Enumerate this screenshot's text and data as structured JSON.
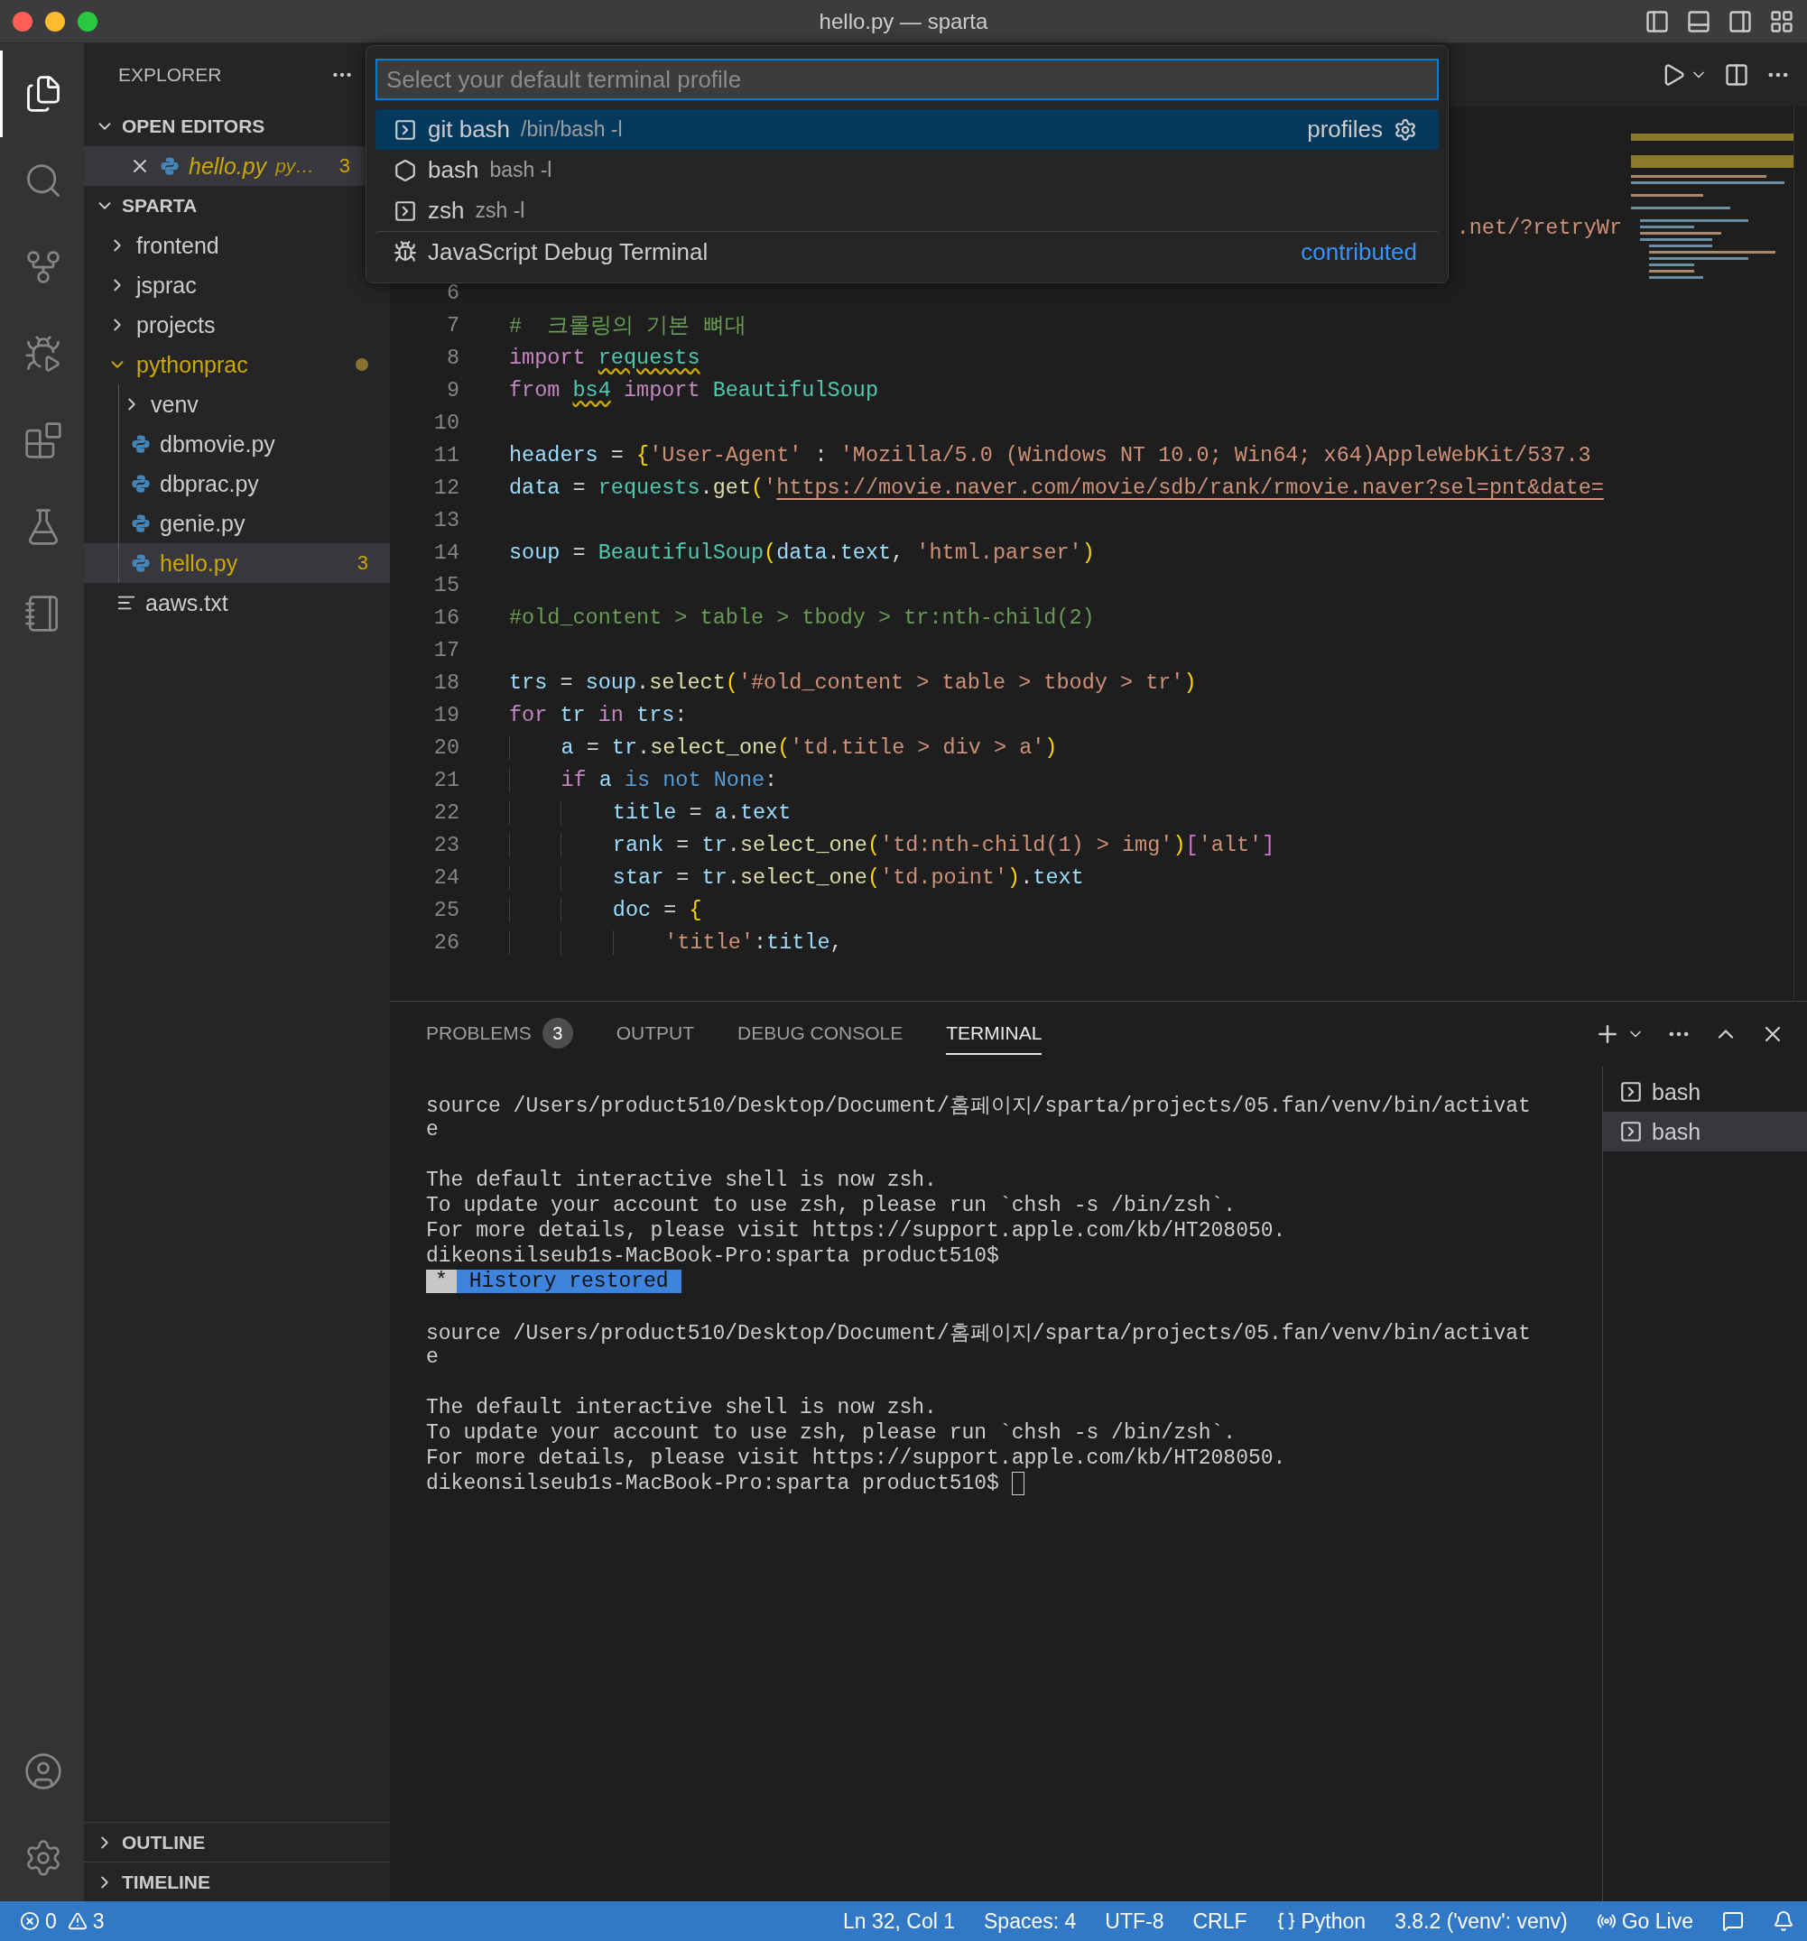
{
  "window": {
    "title": "hello.py — sparta"
  },
  "activity_bar": {
    "items": [
      {
        "kind": "files",
        "selected": true
      },
      {
        "kind": "search",
        "selected": false
      },
      {
        "kind": "source-control",
        "selected": false
      },
      {
        "kind": "run-debug",
        "selected": false
      },
      {
        "kind": "extensions",
        "selected": false
      },
      {
        "kind": "testing",
        "selected": false
      },
      {
        "kind": "notebook",
        "selected": false
      }
    ],
    "bottom": [
      {
        "kind": "account"
      },
      {
        "kind": "settings"
      }
    ]
  },
  "sidebar": {
    "title": "EXPLORER",
    "open_editors": {
      "title": "OPEN EDITORS",
      "expanded": true,
      "items": [
        {
          "name": "hello.py",
          "description": "py…",
          "badge": "3",
          "warning": true,
          "selected": true
        }
      ]
    },
    "tree": {
      "title": "SPARTA",
      "expanded": true,
      "items": [
        {
          "name": "frontend",
          "kind": "folder",
          "expanded": false,
          "warning": false,
          "selected": false
        },
        {
          "name": "jsprac",
          "kind": "folder",
          "expanded": false,
          "warning": false,
          "selected": false
        },
        {
          "name": "projects",
          "kind": "folder",
          "expanded": false,
          "warning": false,
          "selected": false
        },
        {
          "name": "pythonprac",
          "kind": "folder",
          "expanded": true,
          "warning": true,
          "selected": false,
          "children": [
            {
              "name": "venv",
              "kind": "folder",
              "expanded": false,
              "warning": false,
              "selected": false
            },
            {
              "name": "dbmovie.py",
              "kind": "python",
              "warning": false,
              "selected": false
            },
            {
              "name": "dbprac.py",
              "kind": "python",
              "warning": false,
              "selected": false
            },
            {
              "name": "genie.py",
              "kind": "python",
              "warning": false,
              "selected": false
            },
            {
              "name": "hello.py",
              "kind": "python",
              "warning": true,
              "badge": "3",
              "selected": true
            }
          ]
        },
        {
          "name": "aaws.txt",
          "kind": "text",
          "warning": false,
          "selected": false
        }
      ]
    },
    "collapsed_sections": [
      {
        "title": "OUTLINE",
        "expanded": false
      },
      {
        "title": "TIMELINE",
        "expanded": false
      }
    ]
  },
  "quick_pick": {
    "placeholder": "Select your default terminal profile",
    "items": [
      {
        "kind": "terminal",
        "label": "git bash",
        "detail": "/bin/bash -l",
        "action": "profiles",
        "selected": true
      },
      {
        "kind": "shell",
        "label": "bash",
        "detail": "bash -l",
        "selected": false
      },
      {
        "kind": "terminal",
        "label": "zsh",
        "detail": "zsh -l",
        "selected": false
      },
      {
        "kind": "debug",
        "label": "JavaScript Debug Terminal",
        "group": "contributed",
        "separator": true,
        "selected": false
      }
    ]
  },
  "editor": {
    "covered_tail": ".net/?retryWr",
    "lines": [
      {
        "n": "6"
      },
      {
        "n": "7",
        "tokens": [
          {
            "kind": "cmt",
            "text": "#  크롤링의 기본 뼈대"
          }
        ]
      },
      {
        "n": "8",
        "tokens": [
          {
            "kind": "kw",
            "text": "import "
          },
          {
            "kind": "mod",
            "text": "requests",
            "warn": true
          }
        ]
      },
      {
        "n": "9",
        "tokens": [
          {
            "kind": "kw",
            "text": "from "
          },
          {
            "kind": "mod",
            "text": "bs4",
            "warn": true
          },
          {
            "kind": "kw",
            "text": " import "
          },
          {
            "kind": "mod",
            "text": "BeautifulSoup"
          }
        ]
      },
      {
        "n": "10"
      },
      {
        "n": "11",
        "tokens": [
          {
            "kind": "var",
            "text": "headers"
          },
          {
            "kind": "op",
            "text": " = "
          },
          {
            "kind": "brace",
            "text": "{"
          },
          {
            "kind": "str",
            "text": "'User-Agent'"
          },
          {
            "kind": "op",
            "text": " : "
          },
          {
            "kind": "str",
            "text": "'Mozilla/5.0 (Windows NT 10.0; Win64; x64)AppleWebKit/537.3"
          }
        ]
      },
      {
        "n": "12",
        "tokens": [
          {
            "kind": "var",
            "text": "data"
          },
          {
            "kind": "op",
            "text": " = "
          },
          {
            "kind": "mod",
            "text": "requests"
          },
          {
            "kind": "op",
            "text": "."
          },
          {
            "kind": "fn",
            "text": "get"
          },
          {
            "kind": "brace",
            "text": "("
          },
          {
            "kind": "str",
            "text": "'"
          },
          {
            "kind": "link",
            "text": "https://movie.naver.com/movie/sdb/rank/rmovie.naver?sel=pnt&date="
          }
        ]
      },
      {
        "n": "13"
      },
      {
        "n": "14",
        "tokens": [
          {
            "kind": "var",
            "text": "soup"
          },
          {
            "kind": "op",
            "text": " = "
          },
          {
            "kind": "mod",
            "text": "BeautifulSoup"
          },
          {
            "kind": "brace",
            "text": "("
          },
          {
            "kind": "var",
            "text": "data"
          },
          {
            "kind": "op",
            "text": "."
          },
          {
            "kind": "var",
            "text": "text"
          },
          {
            "kind": "op",
            "text": ", "
          },
          {
            "kind": "str",
            "text": "'html.parser'"
          },
          {
            "kind": "brace",
            "text": ")"
          }
        ]
      },
      {
        "n": "15"
      },
      {
        "n": "16",
        "tokens": [
          {
            "kind": "cmt",
            "text": "#old_content > table > tbody > tr:nth-child(2)"
          }
        ]
      },
      {
        "n": "17"
      },
      {
        "n": "18",
        "tokens": [
          {
            "kind": "var",
            "text": "trs"
          },
          {
            "kind": "op",
            "text": " = "
          },
          {
            "kind": "var",
            "text": "soup"
          },
          {
            "kind": "op",
            "text": "."
          },
          {
            "kind": "fn",
            "text": "select"
          },
          {
            "kind": "brace",
            "text": "("
          },
          {
            "kind": "str",
            "text": "'#old_content > table > tbody > tr'"
          },
          {
            "kind": "brace",
            "text": ")"
          }
        ]
      },
      {
        "n": "19",
        "tokens": [
          {
            "kind": "kw",
            "text": "for "
          },
          {
            "kind": "var",
            "text": "tr "
          },
          {
            "kind": "kw",
            "text": "in "
          },
          {
            "kind": "var",
            "text": "trs"
          },
          {
            "kind": "op",
            "text": ":"
          }
        ]
      },
      {
        "n": "20",
        "tokens": [
          {
            "kind": "var",
            "text": "    a"
          },
          {
            "kind": "op",
            "text": " = "
          },
          {
            "kind": "var",
            "text": "tr"
          },
          {
            "kind": "op",
            "text": "."
          },
          {
            "kind": "fn",
            "text": "select_one"
          },
          {
            "kind": "brace",
            "text": "("
          },
          {
            "kind": "str",
            "text": "'td.title > div > a'"
          },
          {
            "kind": "brace",
            "text": ")"
          }
        ]
      },
      {
        "n": "21",
        "tokens": [
          {
            "kind": "kw",
            "text": "    if "
          },
          {
            "kind": "var",
            "text": "a "
          },
          {
            "kind": "const",
            "text": "is not "
          },
          {
            "kind": "const",
            "text": "None"
          },
          {
            "kind": "op",
            "text": ":"
          }
        ]
      },
      {
        "n": "22",
        "tokens": [
          {
            "kind": "var",
            "text": "        title"
          },
          {
            "kind": "op",
            "text": " = "
          },
          {
            "kind": "var",
            "text": "a"
          },
          {
            "kind": "op",
            "text": "."
          },
          {
            "kind": "var",
            "text": "text"
          }
        ]
      },
      {
        "n": "23",
        "tokens": [
          {
            "kind": "var",
            "text": "        rank"
          },
          {
            "kind": "op",
            "text": " = "
          },
          {
            "kind": "var",
            "text": "tr"
          },
          {
            "kind": "op",
            "text": "."
          },
          {
            "kind": "fn",
            "text": "select_one"
          },
          {
            "kind": "brace",
            "text": "("
          },
          {
            "kind": "str",
            "text": "'td:nth-child(1) > img'"
          },
          {
            "kind": "brace",
            "text": ")"
          },
          {
            "kind": "brace2",
            "text": "["
          },
          {
            "kind": "str",
            "text": "'alt'"
          },
          {
            "kind": "brace2",
            "text": "]"
          }
        ]
      },
      {
        "n": "24",
        "tokens": [
          {
            "kind": "var",
            "text": "        star"
          },
          {
            "kind": "op",
            "text": " = "
          },
          {
            "kind": "var",
            "text": "tr"
          },
          {
            "kind": "op",
            "text": "."
          },
          {
            "kind": "fn",
            "text": "select_one"
          },
          {
            "kind": "brace",
            "text": "("
          },
          {
            "kind": "str",
            "text": "'td.point'"
          },
          {
            "kind": "brace",
            "text": ")"
          },
          {
            "kind": "op",
            "text": "."
          },
          {
            "kind": "var",
            "text": "text"
          }
        ]
      },
      {
        "n": "25",
        "tokens": [
          {
            "kind": "var",
            "text": "        doc"
          },
          {
            "kind": "op",
            "text": " = "
          },
          {
            "kind": "brace",
            "text": "{"
          }
        ]
      },
      {
        "n": "26",
        "tokens": [
          {
            "kind": "str",
            "text": "            'title'"
          },
          {
            "kind": "op",
            "text": ":"
          },
          {
            "kind": "var",
            "text": "title"
          },
          {
            "kind": "op",
            "text": ","
          }
        ]
      }
    ]
  },
  "panel": {
    "tabs": [
      {
        "label": "PROBLEMS",
        "badge": "3",
        "selected": false
      },
      {
        "label": "OUTPUT",
        "selected": false
      },
      {
        "label": "DEBUG CONSOLE",
        "selected": false
      },
      {
        "label": "TERMINAL",
        "selected": true
      }
    ],
    "terminal_lines": [
      {
        "kind": "text",
        "text": "source /Users/product510/Desktop/Document/홈페이지/sparta/projects/05.fan/venv/bin/activat"
      },
      {
        "kind": "text",
        "text": "e"
      },
      {
        "kind": "blank"
      },
      {
        "kind": "text",
        "text": "The default interactive shell is now zsh."
      },
      {
        "kind": "text",
        "text": "To update your account to use zsh, please run `chsh -s /bin/zsh`."
      },
      {
        "kind": "text",
        "text": "For more details, please visit https://support.apple.com/kb/HT208050."
      },
      {
        "kind": "text",
        "text": "dikeonsilseub1s-MacBook-Pro:sparta product510$"
      },
      {
        "kind": "badge",
        "mark": "*",
        "text": "History restored"
      },
      {
        "kind": "blank"
      },
      {
        "kind": "text",
        "text": "source /Users/product510/Desktop/Document/홈페이지/sparta/projects/05.fan/venv/bin/activat"
      },
      {
        "kind": "text",
        "text": "e"
      },
      {
        "kind": "blank"
      },
      {
        "kind": "text",
        "text": "The default interactive shell is now zsh."
      },
      {
        "kind": "text",
        "text": "To update your account to use zsh, please run `chsh -s /bin/zsh`."
      },
      {
        "kind": "text",
        "text": "For more details, please visit https://support.apple.com/kb/HT208050."
      },
      {
        "kind": "text",
        "text": "dikeonsilseub1s-MacBook-Pro:sparta product510$",
        "cursor": true
      }
    ],
    "terminals": [
      {
        "label": "bash",
        "selected": false
      },
      {
        "label": "bash",
        "selected": true
      }
    ]
  },
  "status_bar": {
    "left": [
      {
        "kind": "errors",
        "text": "0"
      },
      {
        "kind": "warnings",
        "text": "3"
      }
    ],
    "right": [
      {
        "kind": "text",
        "text": "Ln 32, Col 1"
      },
      {
        "kind": "text",
        "text": "Spaces: 4"
      },
      {
        "kind": "text",
        "text": "UTF-8"
      },
      {
        "kind": "text",
        "text": "CRLF"
      },
      {
        "kind": "language",
        "text": "Python"
      },
      {
        "kind": "text",
        "text": "3.8.2 ('venv': venv)"
      },
      {
        "kind": "live",
        "text": "Go Live"
      },
      {
        "kind": "feedback"
      },
      {
        "kind": "bell"
      }
    ]
  }
}
